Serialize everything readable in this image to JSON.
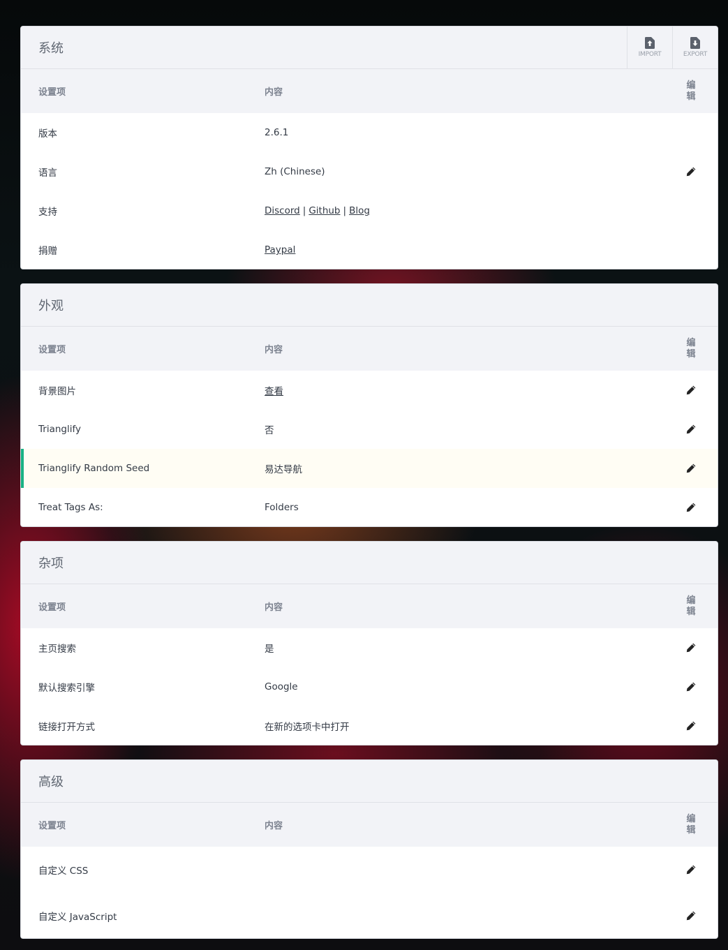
{
  "table_headers": {
    "key": "设置项",
    "value": "内容",
    "edit": "编辑",
    "edit_line1": "编",
    "edit_line2": "辑"
  },
  "actions": {
    "import": "IMPORT",
    "export": "EXPORT"
  },
  "sections": [
    {
      "title": "系统",
      "rows": [
        {
          "key": "版本",
          "value": "2.6.1",
          "editable": false
        },
        {
          "key": "语言",
          "value": "Zh (Chinese)",
          "editable": true
        },
        {
          "key": "支持",
          "links": [
            "Discord",
            "Github",
            "Blog"
          ],
          "separator": "|",
          "editable": false
        },
        {
          "key": "捐赠",
          "link": "Paypal",
          "editable": false
        }
      ]
    },
    {
      "title": "外观",
      "rows": [
        {
          "key": "背景图片",
          "link": "查看",
          "editable": true
        },
        {
          "key": "Trianglify",
          "value": "否",
          "editable": true
        },
        {
          "key": "Trianglify Random Seed",
          "value": "易达导航",
          "editable": true,
          "highlighted": true
        },
        {
          "key": "Treat Tags As:",
          "value": "Folders",
          "editable": true
        }
      ]
    },
    {
      "title": "杂项",
      "rows": [
        {
          "key": "主页搜索",
          "value": "是",
          "editable": true
        },
        {
          "key": "默认搜索引擎",
          "value": "Google",
          "editable": true
        },
        {
          "key": "链接打开方式",
          "value": "在新的选项卡中打开",
          "editable": true
        }
      ]
    },
    {
      "title": "高级",
      "rows": [
        {
          "key": "自定义 CSS",
          "value": "",
          "editable": true
        },
        {
          "key": "自定义 JavaScript",
          "value": "",
          "editable": true
        }
      ]
    }
  ],
  "colors": {
    "accent": "#18b184",
    "highlight_bg": "#fffdf4",
    "header_bg": "#f2f3f7",
    "text": "#333a45",
    "muted": "#7d8390"
  },
  "icons": {
    "import": "file-upload-icon",
    "export": "file-download-icon",
    "edit": "pencil-icon"
  }
}
